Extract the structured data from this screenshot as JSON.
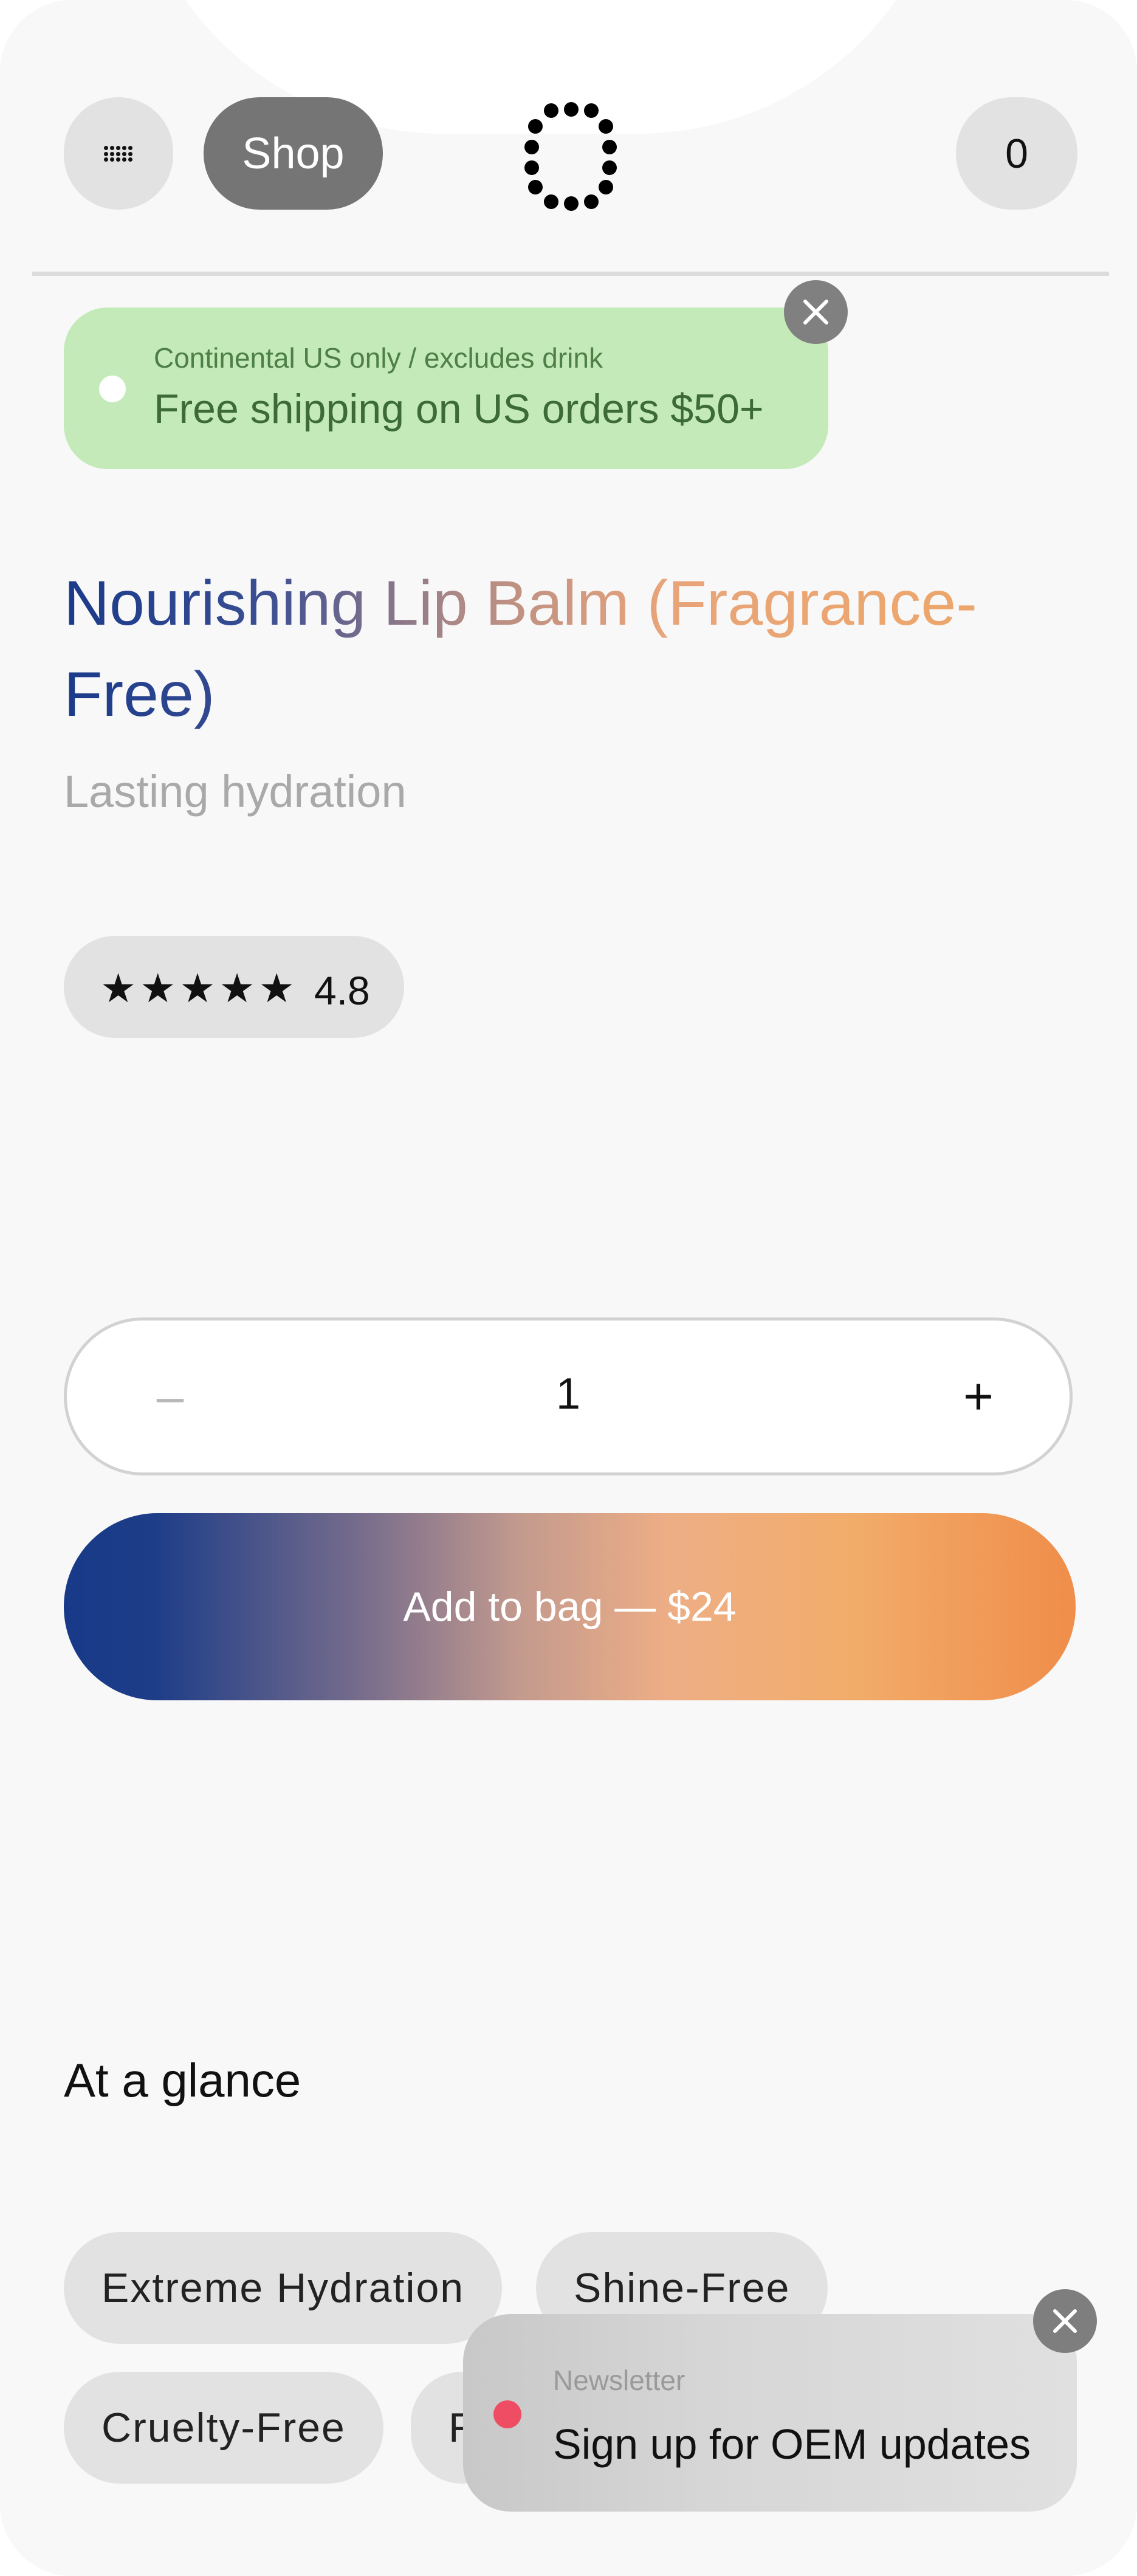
{
  "header": {
    "menu_icon": "grid-dots-icon",
    "shop_label": "Shop",
    "logo_icon": "dotted-ring-logo",
    "cart_count": "0"
  },
  "shipping_banner": {
    "subtitle": "Continental US only / excludes drink",
    "message": "Free shipping on US orders $50+",
    "close_icon": "close-icon",
    "background_color": "#c3eab8"
  },
  "product": {
    "title": "Nourishing Lip Balm (Fragrance-Free)",
    "subtitle": "Lasting hydration",
    "rating": {
      "stars_display": "★★★★★",
      "value": "4.8",
      "star_fill_fraction": 0.96
    }
  },
  "quantity": {
    "decrease_symbol": "–",
    "value": "1",
    "increase_symbol": "+"
  },
  "add_to_bag": {
    "label": "Add to bag — $24",
    "gradient_colors": [
      "#173a88",
      "#c39a8e",
      "#eeae85",
      "#f08d4a"
    ]
  },
  "at_a_glance": {
    "title": "At a glance",
    "chips": [
      "Extreme Hydration",
      "Shine-Free",
      "Cruelty-Free",
      "F"
    ]
  },
  "newsletter": {
    "label": "Newsletter",
    "message": "Sign up for OEM updates",
    "dot_color": "#ef4d63",
    "close_icon": "close-icon"
  }
}
